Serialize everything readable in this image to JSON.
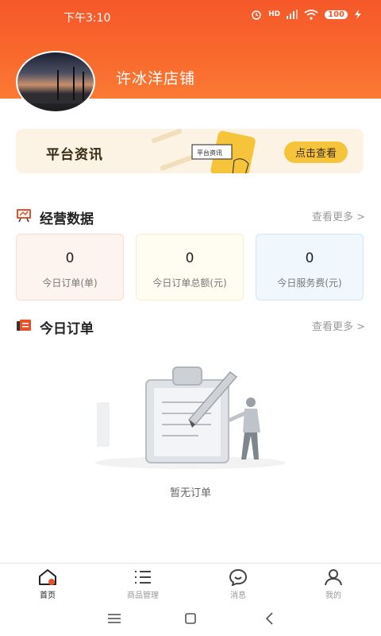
{
  "status_bar": {
    "time": "下午3:10",
    "network": "HD",
    "battery": "100"
  },
  "header": {
    "shop_name": "许冰洋店铺"
  },
  "banner": {
    "title": "平台资讯",
    "button_label": "点击查看",
    "phone_text": "平台资讯"
  },
  "business_data": {
    "title": "经营数据",
    "more_label": "查看更多 >",
    "cards": [
      {
        "value": "0",
        "label": "今日订单(单)"
      },
      {
        "value": "0",
        "label": "今日订单总额(元)"
      },
      {
        "value": "0",
        "label": "今日服务费(元)"
      }
    ]
  },
  "today_orders": {
    "title": "今日订单",
    "more_label": "查看更多 >",
    "empty_text": "暂无订单"
  },
  "tabbar": {
    "items": [
      {
        "label": "首页",
        "icon": "home-icon",
        "active": true
      },
      {
        "label": "商品管理",
        "icon": "list-icon",
        "active": false
      },
      {
        "label": "消息",
        "icon": "message-icon",
        "active": false
      },
      {
        "label": "我的",
        "icon": "user-icon",
        "active": false
      }
    ]
  },
  "colors": {
    "accent": "#f5582a",
    "banner_bg": "#fcf3e5",
    "button_yellow": "#f6c43a"
  }
}
